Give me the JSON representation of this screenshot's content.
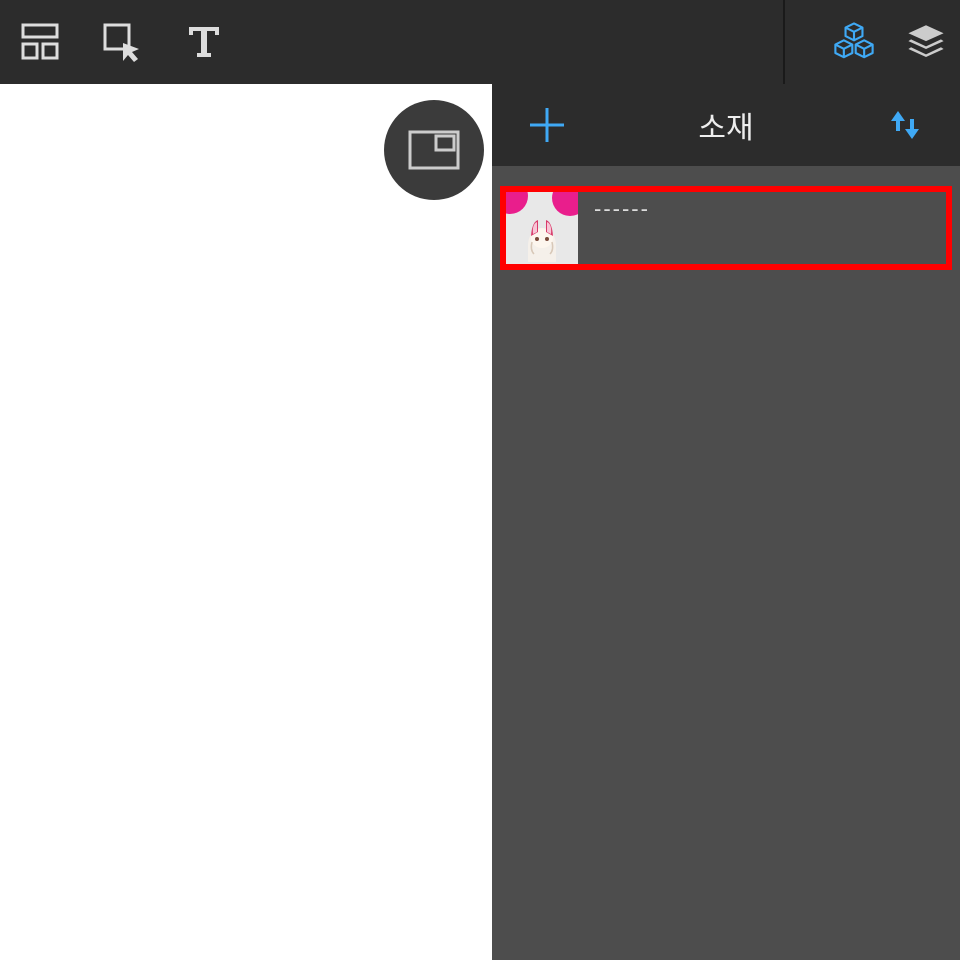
{
  "toolbar": {
    "layout_icon": "layout-icon",
    "select_icon": "select-cursor-icon",
    "text_icon": "text-icon",
    "cubes_icon": "cubes-icon",
    "layers_icon": "layers-icon"
  },
  "canvas": {
    "floating_button": "pip-frame-icon"
  },
  "panel": {
    "add_icon": "plus-icon",
    "title": "소재",
    "sort_icon": "sort-arrows-icon",
    "items": [
      {
        "label": "------"
      }
    ]
  },
  "colors": {
    "accent": "#3fa9f5",
    "highlight_border": "#ff0000"
  }
}
